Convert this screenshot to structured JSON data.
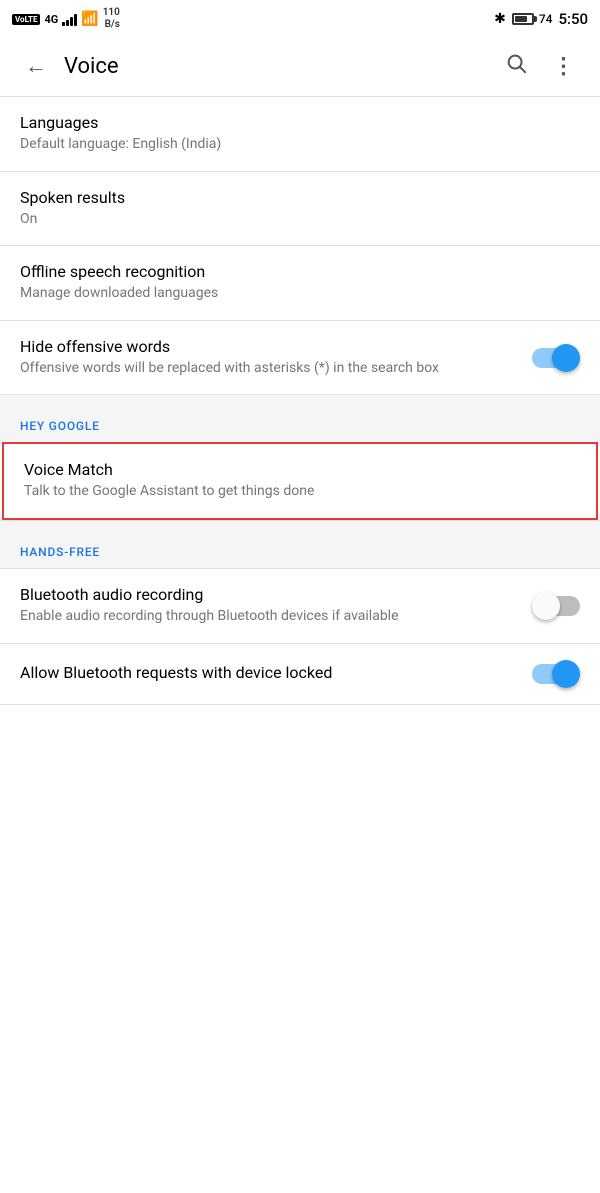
{
  "statusBar": {
    "left": {
      "volte": "VoLTE",
      "signal": "4G",
      "networkSpeed": "110\nB/s"
    },
    "right": {
      "bluetooth": "✱",
      "batteryPercent": "74",
      "time": "5:50"
    }
  },
  "appBar": {
    "title": "Voice",
    "backLabel": "←",
    "searchLabel": "🔍",
    "moreLabel": "⋮"
  },
  "settings": {
    "languages": {
      "title": "Languages",
      "subtitle": "Default language: English (India)"
    },
    "spokenResults": {
      "title": "Spoken results",
      "subtitle": "On"
    },
    "offlineSpeech": {
      "title": "Offline speech recognition",
      "subtitle": "Manage downloaded languages"
    },
    "hideOffensive": {
      "title": "Hide offensive words",
      "subtitle": "Offensive words will be replaced with asterisks (*) in the search box",
      "toggleState": "on"
    },
    "heyGoogleSection": "HEY GOOGLE",
    "voiceMatch": {
      "title": "Voice Match",
      "subtitle": "Talk to the Google Assistant to get things done"
    },
    "handsFreeSection": "HANDS-FREE",
    "bluetoothRecording": {
      "title": "Bluetooth audio recording",
      "subtitle": "Enable audio recording through Bluetooth devices if available",
      "toggleState": "off"
    },
    "bluetoothRequests": {
      "title": "Allow Bluetooth requests with device locked",
      "toggleState": "on"
    }
  }
}
